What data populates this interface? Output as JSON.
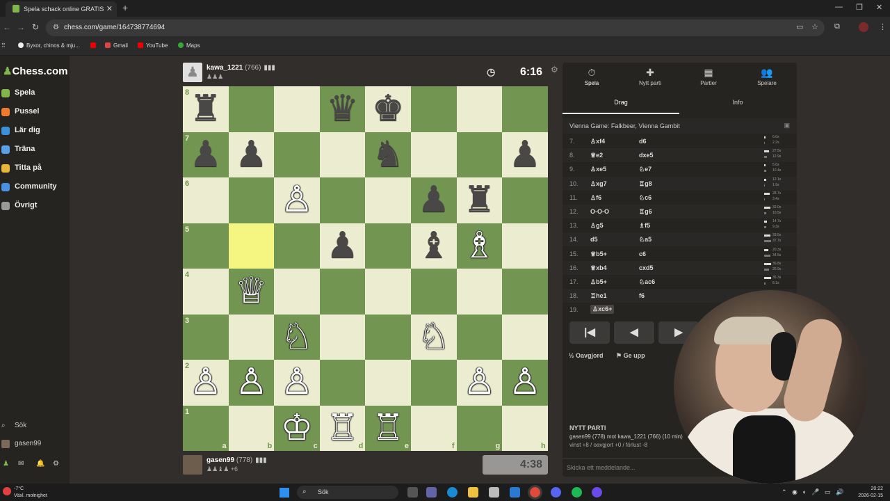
{
  "browser": {
    "tab_title": "Spela schack online GRATIS",
    "tab_close": "✕",
    "new_tab": "+",
    "url": "chess.com/game/164738774694",
    "bookmarks": [
      "Byxor, chinos & mju...",
      "Gmail",
      "YouTube",
      "Maps"
    ]
  },
  "sidebar": {
    "logo": "Chess.com",
    "items": [
      {
        "label": "Spela",
        "color": "#81b64c"
      },
      {
        "label": "Pussel",
        "color": "#f07a2e"
      },
      {
        "label": "Lär dig",
        "color": "#3d8fd8"
      },
      {
        "label": "Träna",
        "color": "#5aa0e8"
      },
      {
        "label": "Titta på",
        "color": "#e8b63a"
      },
      {
        "label": "Community",
        "color": "#4a90e2"
      },
      {
        "label": "Övrigt",
        "color": "#999999"
      }
    ],
    "search": "Sök",
    "user": "gasen99"
  },
  "opponent": {
    "name": "kawa_1221",
    "rating": "(766)",
    "extra": "ℹ",
    "clock": "6:16"
  },
  "player": {
    "name": "gasen99",
    "rating": "(778)",
    "extra": "+6",
    "clock": "4:38"
  },
  "board": {
    "ranks": [
      "8",
      "7",
      "6",
      "5",
      "4",
      "3",
      "2",
      "1"
    ],
    "files": [
      "a",
      "b",
      "c",
      "d",
      "e",
      "f",
      "g",
      "h"
    ],
    "highlight": "b5",
    "pieces": [
      {
        "sq": "a8",
        "p": "♜",
        "c": "b"
      },
      {
        "sq": "d8",
        "p": "♛",
        "c": "b"
      },
      {
        "sq": "e8",
        "p": "♚",
        "c": "b"
      },
      {
        "sq": "a7",
        "p": "♟",
        "c": "b"
      },
      {
        "sq": "b7",
        "p": "♟",
        "c": "b"
      },
      {
        "sq": "e7",
        "p": "♞",
        "c": "b"
      },
      {
        "sq": "h7",
        "p": "♟",
        "c": "b"
      },
      {
        "sq": "c6",
        "p": "♙",
        "c": "w"
      },
      {
        "sq": "f6",
        "p": "♟",
        "c": "b"
      },
      {
        "sq": "g6",
        "p": "♜",
        "c": "b"
      },
      {
        "sq": "d5",
        "p": "♟",
        "c": "b"
      },
      {
        "sq": "f5",
        "p": "♝",
        "c": "b"
      },
      {
        "sq": "g5",
        "p": "♗",
        "c": "w"
      },
      {
        "sq": "b4",
        "p": "♕",
        "c": "w"
      },
      {
        "sq": "c3",
        "p": "♘",
        "c": "w"
      },
      {
        "sq": "f3",
        "p": "♘",
        "c": "w"
      },
      {
        "sq": "a2",
        "p": "♙",
        "c": "w"
      },
      {
        "sq": "b2",
        "p": "♙",
        "c": "w"
      },
      {
        "sq": "c2",
        "p": "♙",
        "c": "w"
      },
      {
        "sq": "g2",
        "p": "♙",
        "c": "w"
      },
      {
        "sq": "h2",
        "p": "♙",
        "c": "w"
      },
      {
        "sq": "c1",
        "p": "♔",
        "c": "w"
      },
      {
        "sq": "d1",
        "p": "♖",
        "c": "w"
      },
      {
        "sq": "e1",
        "p": "♖",
        "c": "w"
      }
    ]
  },
  "panel": {
    "tabs": [
      {
        "label": "Spela",
        "icon": "⏱"
      },
      {
        "label": "Nytt parti",
        "icon": "✚"
      },
      {
        "label": "Partier",
        "icon": "▦"
      },
      {
        "label": "Spelare",
        "icon": "👥"
      }
    ],
    "subtabs": [
      "Drag",
      "Info"
    ],
    "opening": "Vienna Game: Falkbeer, Vienna Gambit",
    "moves": [
      {
        "n": "7.",
        "w": "♙xf4",
        "b": "d6",
        "tw": "6.6s",
        "tb": "2.2s"
      },
      {
        "n": "8.",
        "w": "♕e2",
        "b": "dxe5",
        "tw": "27.5s",
        "tb": "12.9s"
      },
      {
        "n": "9.",
        "w": "♙xe5",
        "b": "♘e7",
        "tw": "5.6s",
        "tb": "10.4s"
      },
      {
        "n": "10.",
        "w": "♙xg7",
        "b": "♖g8",
        "tw": "12.1s",
        "tb": "1.9s"
      },
      {
        "n": "11.",
        "w": "♙f6",
        "b": "♘c6",
        "tw": "28.7s",
        "tb": "3.4s"
      },
      {
        "n": "12.",
        "w": "O-O-O",
        "b": "♖g6",
        "tw": "32.0s",
        "tb": "10.5s"
      },
      {
        "n": "13.",
        "w": "♙g5",
        "b": "♗f5",
        "tw": "14.7s",
        "tb": "9.3s"
      },
      {
        "n": "14.",
        "w": "d5",
        "b": "♘a5",
        "tw": "33.5s",
        "tb": "37.7s"
      },
      {
        "n": "15.",
        "w": "♕b5+",
        "b": "c6",
        "tw": "20.3s",
        "tb": "34.5s"
      },
      {
        "n": "16.",
        "w": "♕xb4",
        "b": "cxd5",
        "tw": "36.8s",
        "tb": "26.9s"
      },
      {
        "n": "17.",
        "w": "♙b5+",
        "b": "♘ac6",
        "tw": "35.3s",
        "tb": "8.1s"
      },
      {
        "n": "18.",
        "w": "♖he1",
        "b": "f6",
        "tw": "",
        "tb": ""
      },
      {
        "n": "19.",
        "w": "♙xc6+",
        "b": "",
        "tw": "",
        "tb": ""
      }
    ],
    "controls": [
      "|◀",
      "◀",
      "▶"
    ],
    "draw": "Oavgjord",
    "resign": "Ge upp",
    "new_game_title": "NYTT PARTI",
    "new_game_desc": "gasen99 (778) mot kawa_1221 (766) (10 min)",
    "new_game_score": "vinst +8 / oavgjort +0 / förlust -8",
    "chat_placeholder": "Skicka ett meddelande..."
  },
  "taskbar": {
    "temp": "-7°C",
    "weather": "Växl. molnighet",
    "search": "Sök",
    "time": "20:22",
    "date": "2026-02-15"
  }
}
